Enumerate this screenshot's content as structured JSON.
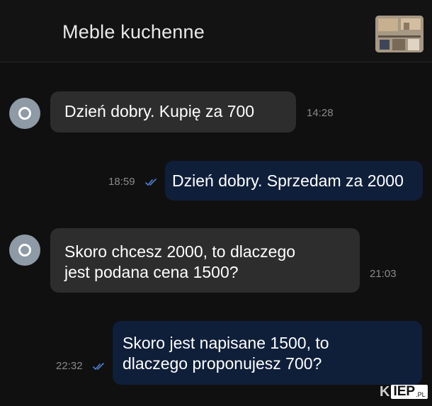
{
  "header": {
    "title": "Meble kuchenne"
  },
  "messages": [
    {
      "direction": "incoming",
      "text": "Dzień dobry. Kupię za 700",
      "time": "14:28"
    },
    {
      "direction": "outgoing",
      "text": "Dzień dobry. Sprzedam za 2000",
      "time": "18:59",
      "read": true
    },
    {
      "direction": "incoming",
      "text": "Skoro chcesz 2000, to dlaczego\njest podana cena 1500?",
      "time": "21:03"
    },
    {
      "direction": "outgoing",
      "text": "Skoro jest napisane 1500, to\ndlaczego proponujesz 700?",
      "time": "22:32",
      "read": true
    }
  ],
  "colors": {
    "background": "#101010",
    "incoming_bubble": "#2d2d2d",
    "outgoing_bubble": "#0f1f3a",
    "read_ticks": "#4f7fd6",
    "avatar": "#8e9aa6"
  },
  "icons": {
    "avatar": "avatar-icon",
    "read_receipt": "double-check-icon"
  },
  "watermark": {
    "logo": "KIEP.PL"
  }
}
